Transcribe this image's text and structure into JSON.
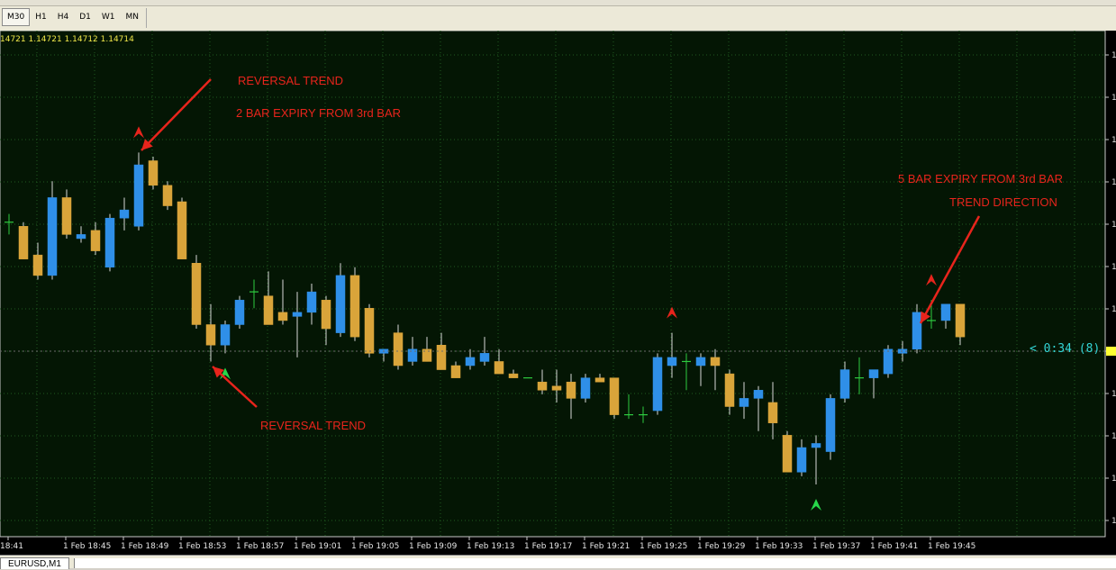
{
  "toolbar": {
    "timeframes": [
      "M30",
      "H1",
      "H4",
      "D1",
      "W1",
      "MN"
    ],
    "selected": "M30"
  },
  "chart": {
    "ohlc_label": "14721 1.14721 1.14712 1.14714",
    "timer_label": "< 0:34 (8)",
    "time_labels": [
      "18:41",
      "1 Feb 18:45",
      "1 Feb 18:49",
      "1 Feb 18:53",
      "1 Feb 18:57",
      "1 Feb 19:01",
      "1 Feb 19:05",
      "1 Feb 19:09",
      "1 Feb 19:13",
      "1 Feb 19:17",
      "1 Feb 19:21",
      "1 Feb 19:25",
      "1 Feb 19:29",
      "1 Feb 19:33",
      "1 Feb 19:37",
      "1 Feb 19:41",
      "1 Feb 19:45"
    ],
    "price_axis_labels": [
      "1",
      "1",
      "1",
      "1",
      "1",
      "1",
      "1",
      "1",
      "1",
      "1",
      "1",
      "1",
      "1"
    ],
    "annotations": [
      "REVERSAL TREND",
      "2 BAR EXPIRY FROM 3rd BAR",
      "REVERSAL TREND",
      "5 BAR EXPIRY FROM 3rd BAR",
      "TREND DIRECTION"
    ],
    "colors": {
      "background": "#000000",
      "plot_background": "#041604",
      "grid": "#1f5a1f",
      "axis": "#c8c8c8",
      "bull": "#2f8fe8",
      "bear": "#d9a43a",
      "doji": "#2ecc40",
      "annotation": "#e8241c",
      "timer": "#33d6d6",
      "price_marker": "#ffff33"
    }
  },
  "chart_data": {
    "type": "candlestick",
    "series_note": "EURUSD M1 one-minute candles, values estimated on a relative 0-100 price scale",
    "candles": [
      {
        "t": "18:41",
        "o": 50,
        "h": 52,
        "l": 47,
        "c": 50
      },
      {
        "t": "18:42",
        "o": 49,
        "h": 50,
        "l": 41,
        "c": 41
      },
      {
        "t": "18:43",
        "o": 42,
        "h": 45,
        "l": 36,
        "c": 37
      },
      {
        "t": "18:44",
        "o": 37,
        "h": 60,
        "l": 36,
        "c": 56
      },
      {
        "t": "18:45",
        "o": 56,
        "h": 58,
        "l": 46,
        "c": 47
      },
      {
        "t": "18:46",
        "o": 46,
        "h": 49,
        "l": 45,
        "c": 47
      },
      {
        "t": "18:47",
        "o": 48,
        "h": 50,
        "l": 42,
        "c": 43
      },
      {
        "t": "18:48",
        "o": 39,
        "h": 52,
        "l": 38,
        "c": 51
      },
      {
        "t": "18:49",
        "o": 51,
        "h": 56,
        "l": 48,
        "c": 53
      },
      {
        "t": "18:50",
        "o": 49,
        "h": 67,
        "l": 48,
        "c": 64
      },
      {
        "t": "18:51",
        "o": 65,
        "h": 66,
        "l": 58,
        "c": 59
      },
      {
        "t": "18:52",
        "o": 59,
        "h": 60,
        "l": 53,
        "c": 54
      },
      {
        "t": "18:53",
        "o": 55,
        "h": 56,
        "l": 41,
        "c": 41
      },
      {
        "t": "18:54",
        "o": 40,
        "h": 42,
        "l": 24,
        "c": 25
      },
      {
        "t": "18:55",
        "o": 25,
        "h": 30,
        "l": 16,
        "c": 20
      },
      {
        "t": "18:56",
        "o": 20,
        "h": 26,
        "l": 18,
        "c": 25
      },
      {
        "t": "18:57",
        "o": 25,
        "h": 32,
        "l": 24,
        "c": 31
      },
      {
        "t": "18:58",
        "o": 33,
        "h": 36,
        "l": 29,
        "c": 33
      },
      {
        "t": "18:59",
        "o": 32,
        "h": 38,
        "l": 25,
        "c": 25
      },
      {
        "t": "19:00",
        "o": 28,
        "h": 36,
        "l": 25,
        "c": 26
      },
      {
        "t": "19:01",
        "o": 27,
        "h": 33,
        "l": 17,
        "c": 28
      },
      {
        "t": "19:02",
        "o": 28,
        "h": 35,
        "l": 25,
        "c": 33
      },
      {
        "t": "19:03",
        "o": 31,
        "h": 32,
        "l": 20,
        "c": 24
      },
      {
        "t": "19:04",
        "o": 23,
        "h": 40,
        "l": 22,
        "c": 37
      },
      {
        "t": "19:05",
        "o": 37,
        "h": 39,
        "l": 21,
        "c": 22
      },
      {
        "t": "19:06",
        "o": 29,
        "h": 30,
        "l": 17,
        "c": 18
      },
      {
        "t": "19:07",
        "o": 18,
        "h": 19,
        "l": 16,
        "c": 19
      },
      {
        "t": "19:08",
        "o": 23,
        "h": 25,
        "l": 14,
        "c": 15
      },
      {
        "t": "19:09",
        "o": 16,
        "h": 22,
        "l": 15,
        "c": 19
      },
      {
        "t": "19:10",
        "o": 19,
        "h": 22,
        "l": 16,
        "c": 16
      },
      {
        "t": "19:11",
        "o": 20,
        "h": 23,
        "l": 14,
        "c": 14
      },
      {
        "t": "19:12",
        "o": 15,
        "h": 16,
        "l": 12,
        "c": 12
      },
      {
        "t": "19:13",
        "o": 15,
        "h": 19,
        "l": 14,
        "c": 17
      },
      {
        "t": "19:14",
        "o": 16,
        "h": 22,
        "l": 15,
        "c": 18
      },
      {
        "t": "19:15",
        "o": 16,
        "h": 19,
        "l": 13,
        "c": 13
      },
      {
        "t": "19:16",
        "o": 13,
        "h": 14,
        "l": 12,
        "c": 12
      },
      {
        "t": "19:17",
        "o": 12,
        "h": 12,
        "l": 12,
        "c": 12
      },
      {
        "t": "19:18",
        "o": 11,
        "h": 14,
        "l": 8,
        "c": 9
      },
      {
        "t": "19:19",
        "o": 10,
        "h": 14,
        "l": 6,
        "c": 9
      },
      {
        "t": "19:20",
        "o": 11,
        "h": 13,
        "l": 2,
        "c": 7
      },
      {
        "t": "19:21",
        "o": 7,
        "h": 13,
        "l": 6,
        "c": 12
      },
      {
        "t": "19:22",
        "o": 12,
        "h": 13,
        "l": 11,
        "c": 11
      },
      {
        "t": "19:23",
        "o": 12,
        "h": 12,
        "l": 2,
        "c": 3
      },
      {
        "t": "19:24",
        "o": 3,
        "h": 8,
        "l": 2,
        "c": 3
      },
      {
        "t": "19:25",
        "o": 3,
        "h": 5,
        "l": 1,
        "c": 3
      },
      {
        "t": "19:26",
        "o": 4,
        "h": 18,
        "l": 3,
        "c": 17
      },
      {
        "t": "19:27",
        "o": 15,
        "h": 23,
        "l": 12,
        "c": 17
      },
      {
        "t": "19:28",
        "o": 16,
        "h": 18,
        "l": 9,
        "c": 16
      },
      {
        "t": "19:29",
        "o": 15,
        "h": 18,
        "l": 10,
        "c": 17
      },
      {
        "t": "19:30",
        "o": 17,
        "h": 19,
        "l": 9,
        "c": 15
      },
      {
        "t": "19:31",
        "o": 13,
        "h": 14,
        "l": 3,
        "c": 5
      },
      {
        "t": "19:32",
        "o": 5,
        "h": 11,
        "l": 2,
        "c": 7
      },
      {
        "t": "19:33",
        "o": 7,
        "h": 10,
        "l": -1,
        "c": 9
      },
      {
        "t": "19:34",
        "o": 6,
        "h": 11,
        "l": -3,
        "c": 1
      },
      {
        "t": "19:35",
        "o": -2,
        "h": -1,
        "l": -11,
        "c": -11
      },
      {
        "t": "19:36",
        "o": -11,
        "h": -3,
        "l": -12,
        "c": -5
      },
      {
        "t": "19:37",
        "o": -5,
        "h": -2,
        "l": -14,
        "c": -4
      },
      {
        "t": "19:38",
        "o": -6,
        "h": 8,
        "l": -8,
        "c": 7
      },
      {
        "t": "19:39",
        "o": 7,
        "h": 16,
        "l": 6,
        "c": 14
      },
      {
        "t": "19:40",
        "o": 12,
        "h": 17,
        "l": 8,
        "c": 12
      },
      {
        "t": "19:41",
        "o": 12,
        "h": 13,
        "l": 7,
        "c": 14
      },
      {
        "t": "19:42",
        "o": 13,
        "h": 20,
        "l": 12,
        "c": 19
      },
      {
        "t": "19:43",
        "o": 18,
        "h": 21,
        "l": 16,
        "c": 19
      },
      {
        "t": "19:44",
        "o": 19,
        "h": 30,
        "l": 18,
        "c": 28
      },
      {
        "t": "19:45",
        "o": 26,
        "h": 31,
        "l": 24,
        "c": 26
      },
      {
        "t": "19:46",
        "o": 26,
        "h": 30,
        "l": 24,
        "c": 30
      },
      {
        "t": "19:47",
        "o": 30,
        "h": 30,
        "l": 20,
        "c": 22
      }
    ],
    "signals": [
      {
        "t": "18:50",
        "direction": "down",
        "color": "red"
      },
      {
        "t": "18:56",
        "direction": "up",
        "color": "green"
      },
      {
        "t": "19:27",
        "direction": "down",
        "color": "red"
      },
      {
        "t": "19:37",
        "direction": "up",
        "color": "green"
      },
      {
        "t": "19:45",
        "direction": "down",
        "color": "red"
      }
    ]
  },
  "status": {
    "tab_label": "EURUSD,M1"
  }
}
